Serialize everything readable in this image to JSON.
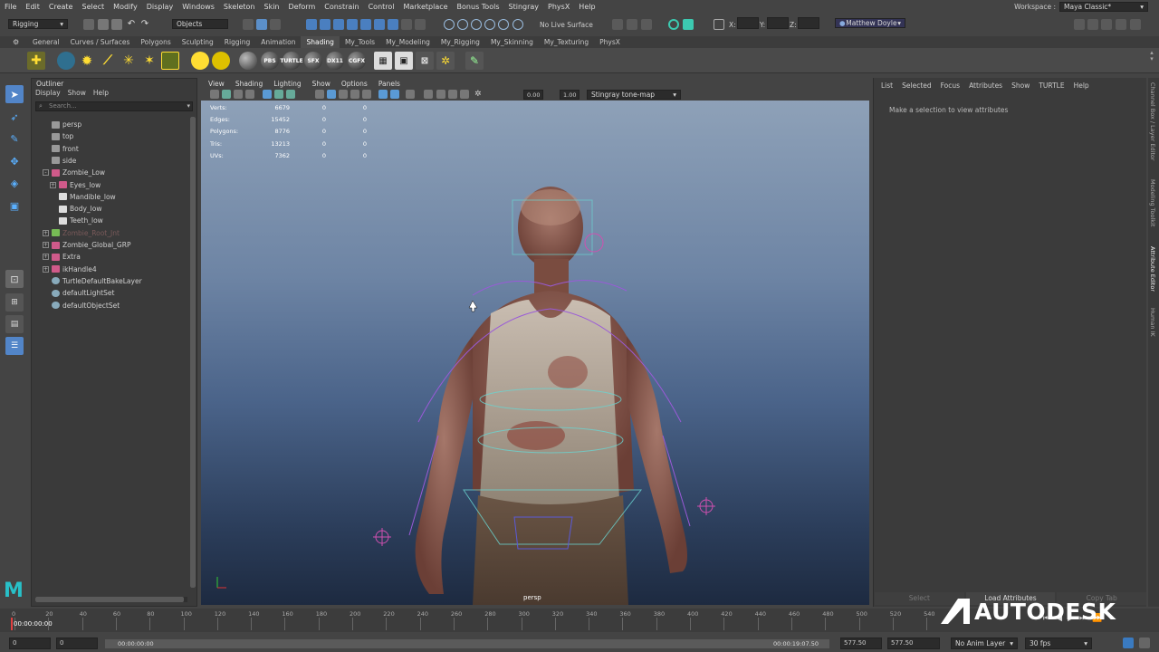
{
  "menubar": {
    "items": [
      "File",
      "Edit",
      "Create",
      "Select",
      "Modify",
      "Display",
      "Windows",
      "Skeleton",
      "Skin",
      "Deform",
      "Constrain",
      "Control",
      "Marketplace",
      "Bonus Tools",
      "Stingray",
      "PhysX",
      "Help"
    ],
    "workspace_label": "Workspace :",
    "workspace_value": "Maya Classic*"
  },
  "statusline": {
    "mode": "Rigging",
    "selection_mask": "Objects",
    "live_surface": "No Live Surface",
    "x_label": "X:",
    "y_label": "Y:",
    "z_label": "Z:",
    "user": "Matthew Doyle"
  },
  "shelf": {
    "tabs": [
      "General",
      "Curves / Surfaces",
      "Polygons",
      "Sculpting",
      "Rigging",
      "Animation",
      "Shading",
      "My_Tools",
      "My_Modeling",
      "My_Rigging",
      "My_Skinning",
      "My_Texturing",
      "PhysX"
    ],
    "active_tab": "Shading",
    "icon_labels": [
      "PBS",
      "TURTLE",
      "SFX",
      "DX11",
      "CGFX"
    ]
  },
  "outliner": {
    "title": "Outliner",
    "menus": [
      "Display",
      "Show",
      "Help"
    ],
    "search_placeholder": "Search...",
    "items": [
      {
        "label": "persp",
        "type": "camera"
      },
      {
        "label": "top",
        "type": "camera"
      },
      {
        "label": "front",
        "type": "camera"
      },
      {
        "label": "side",
        "type": "camera"
      },
      {
        "label": "Zombie_Low",
        "type": "group"
      },
      {
        "label": "Eyes_low",
        "type": "group"
      },
      {
        "label": "Mandible_low",
        "type": "mesh"
      },
      {
        "label": "Body_low",
        "type": "mesh"
      },
      {
        "label": "Teeth_low",
        "type": "mesh"
      },
      {
        "label": "Zombie_Root_Jnt",
        "type": "joint"
      },
      {
        "label": "Zombie_Global_GRP",
        "type": "group"
      },
      {
        "label": "Extra",
        "type": "group"
      },
      {
        "label": "ikHandle4",
        "type": "ik"
      },
      {
        "label": "TurtleDefaultBakeLayer",
        "type": "set"
      },
      {
        "label": "defaultLightSet",
        "type": "set"
      },
      {
        "label": "defaultObjectSet",
        "type": "set"
      }
    ]
  },
  "viewport": {
    "menus": [
      "View",
      "Shading",
      "Lighting",
      "Show",
      "Options",
      "Panels"
    ],
    "field_a": "0.00",
    "field_b": "1.00",
    "tonemap": "Stingray tone-map",
    "camera": "persp",
    "hud": [
      {
        "label": "Verts:",
        "v1": "6679",
        "v2": "0",
        "v3": "0"
      },
      {
        "label": "Edges:",
        "v1": "15452",
        "v2": "0",
        "v3": "0"
      },
      {
        "label": "Polygons:",
        "v1": "8776",
        "v2": "0",
        "v3": "0"
      },
      {
        "label": "Tris:",
        "v1": "13213",
        "v2": "0",
        "v3": "0"
      },
      {
        "label": "UVs:",
        "v1": "7362",
        "v2": "0",
        "v3": "0"
      }
    ]
  },
  "attribute_editor": {
    "menus": [
      "List",
      "Selected",
      "Focus",
      "Attributes",
      "Show",
      "TURTLE",
      "Help"
    ],
    "message": "Make a selection to view attributes",
    "buttons": [
      "Select",
      "Load Attributes",
      "Copy Tab"
    ],
    "side_tabs": [
      "Channel Box / Layer Editor",
      "Modeling Toolkit",
      "Attribute Editor",
      "Human IK"
    ]
  },
  "timeline": {
    "ticks": [
      "0",
      "20",
      "40",
      "60",
      "80",
      "100",
      "120",
      "140",
      "160",
      "180",
      "200",
      "220",
      "240",
      "260",
      "280",
      "300",
      "320",
      "340",
      "360",
      "380",
      "400",
      "420",
      "440",
      "460",
      "480",
      "500",
      "520",
      "540"
    ],
    "current_time": "00:00:00:00"
  },
  "rangebar": {
    "start": "0",
    "start_inner": "0",
    "range_start_time": "00:00:00:00",
    "range_end_time": "00:00:19:07.50",
    "end_inner": "577.50",
    "end": "577.50",
    "anim_layer": "No Anim Layer",
    "fps": "30 fps"
  },
  "brand": {
    "text": "AUTODESK"
  }
}
